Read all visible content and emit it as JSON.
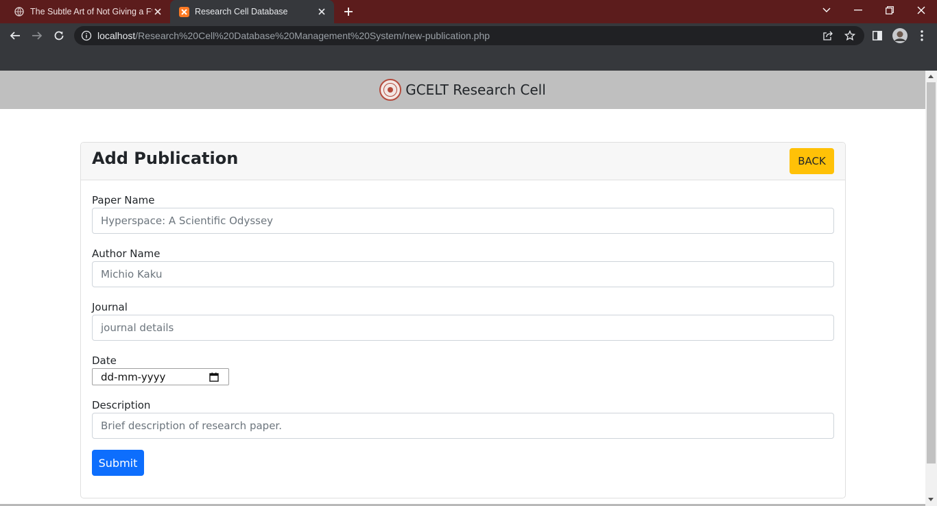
{
  "browser": {
    "tabs": [
      {
        "title": "The Subtle Art of Not Giving a F*",
        "active": false,
        "icon": "globe-icon"
      },
      {
        "title": "Research Cell Database",
        "active": true,
        "icon": "xampp-icon"
      }
    ],
    "url_host": "localhost",
    "url_path": "/Research%20Cell%20Database%20Management%20System/new-publication.php",
    "colors": {
      "tabbar": "#5c1c1c",
      "toolbar": "#36383c"
    }
  },
  "site": {
    "title": "GCELT Research Cell",
    "logo": "college-seal-logo"
  },
  "form": {
    "heading": "Add Publication",
    "back_label": "BACK",
    "fields": {
      "paper_name": {
        "label": "Paper Name",
        "placeholder": "Hyperspace: A Scientific Odyssey"
      },
      "author_name": {
        "label": "Author Name",
        "placeholder": "Michio Kaku"
      },
      "journal": {
        "label": "Journal",
        "placeholder": "journal details"
      },
      "date": {
        "label": "Date",
        "placeholder": "dd-mm-yyyy"
      },
      "description": {
        "label": "Description",
        "placeholder": "Brief description of research paper."
      }
    },
    "submit_label": "Submit",
    "colors": {
      "back_button": "#ffc107",
      "submit_button": "#0d6efd"
    }
  }
}
